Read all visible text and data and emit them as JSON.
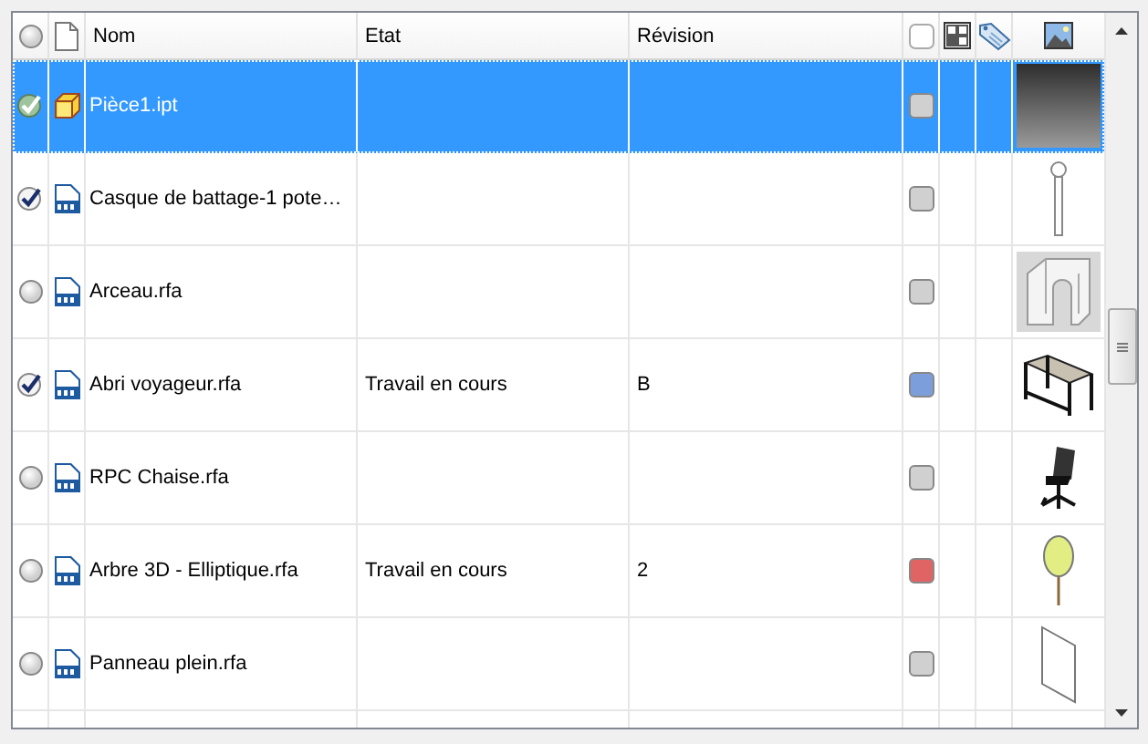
{
  "columns": [
    {
      "kind": "check"
    },
    {
      "kind": "type"
    },
    {
      "kind": "text",
      "label": "Nom"
    },
    {
      "kind": "text",
      "label": "Etat"
    },
    {
      "kind": "text",
      "label": "Révision"
    },
    {
      "kind": "status"
    },
    {
      "kind": "grid"
    },
    {
      "kind": "tag"
    },
    {
      "kind": "image"
    }
  ],
  "rows": [
    {
      "selected": true,
      "checked": true,
      "file_icon": {
        "kind": "cube"
      },
      "name": "Pièce1.ipt",
      "color": "#d0d0d0",
      "thumbnail": {
        "kind": "gradient"
      }
    },
    {
      "selected": false,
      "checked": true,
      "file_icon": {
        "kind": "family"
      },
      "name": "Casque de battage-1 pote…",
      "color": "#d0d0d0",
      "thumbnail": {
        "kind": "post"
      }
    },
    {
      "selected": false,
      "checked": false,
      "file_icon": {
        "kind": "family"
      },
      "name": "Arceau.rfa",
      "color": "#d0d0d0",
      "thumbnail": {
        "kind": "arch"
      }
    },
    {
      "selected": false,
      "checked": true,
      "file_icon": {
        "kind": "family"
      },
      "name": "Abri voyageur.rfa",
      "etat": "Travail en cours",
      "revision": "B",
      "color": "#7c9fdc",
      "thumbnail": {
        "kind": "desk"
      }
    },
    {
      "selected": false,
      "checked": false,
      "file_icon": {
        "kind": "family"
      },
      "name": "RPC Chaise.rfa",
      "color": "#d0d0d0",
      "thumbnail": {
        "kind": "chair"
      }
    },
    {
      "selected": false,
      "checked": false,
      "file_icon": {
        "kind": "family"
      },
      "name": "Arbre 3D - Elliptique.rfa",
      "etat": "Travail en cours",
      "revision": "2",
      "color": "#e06464",
      "thumbnail": {
        "kind": "tree"
      }
    },
    {
      "selected": false,
      "checked": false,
      "file_icon": {
        "kind": "family"
      },
      "name": "Panneau plein.rfa",
      "color": "#d0d0d0",
      "thumbnail": {
        "kind": "panel"
      }
    }
  ]
}
